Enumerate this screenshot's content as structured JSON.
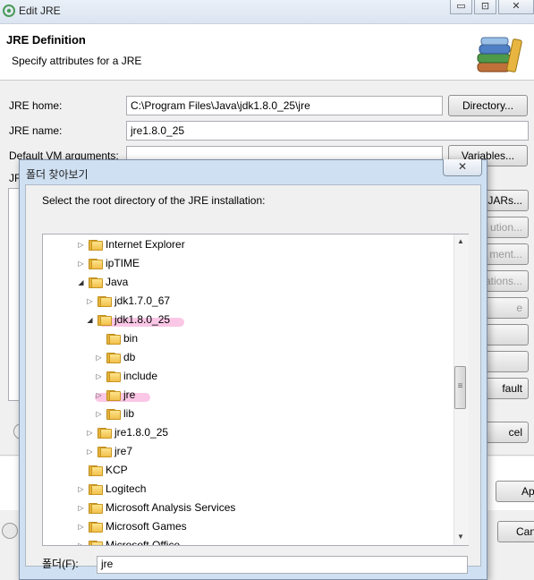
{
  "window": {
    "title": "Edit JRE",
    "controls": [
      "▭",
      "⊡",
      "✕"
    ]
  },
  "header": {
    "title": "JRE Definition",
    "subtitle": "Specify attributes for a JRE"
  },
  "form": {
    "jre_home_label": "JRE home:",
    "jre_home_value": "C:\\Program Files\\Java\\jdk1.8.0_25\\jre",
    "directory_button": "Directory...",
    "jre_name_label": "JRE name:",
    "jre_name_value": "jre1.8.0_25",
    "default_vm_label": "Default VM arguments:",
    "variables_button": "Variables...",
    "jre_libs_label_partial": "JR"
  },
  "side_buttons": [
    "JARs...",
    "ution...",
    "ment...",
    "ations...",
    "e",
    "",
    "",
    "fault"
  ],
  "bottom": {
    "cancel_partial": "cel",
    "apply_partial": "Ap",
    "cancel2_partial": "Can"
  },
  "dialog": {
    "title": "폴더 찾아보기",
    "close_glyph": "✕",
    "description": "Select the root directory of the JRE installation:",
    "folder_label": "폴더(F):",
    "folder_value": "jre",
    "tree": [
      {
        "name": "Internet Explorer",
        "twisty": "▷"
      },
      {
        "name": "ipTIME",
        "twisty": "▷"
      },
      {
        "name": "Java",
        "twisty": "◢"
      },
      {
        "name": "jdk1.7.0_67",
        "twisty": "▷"
      },
      {
        "name": "jdk1.8.0_25",
        "twisty": "◢"
      },
      {
        "name": "bin",
        "twisty": ""
      },
      {
        "name": "db",
        "twisty": "▷"
      },
      {
        "name": "include",
        "twisty": "▷"
      },
      {
        "name": "jre",
        "twisty": "▷"
      },
      {
        "name": "lib",
        "twisty": "▷"
      },
      {
        "name": "jre1.8.0_25",
        "twisty": "▷"
      },
      {
        "name": "jre7",
        "twisty": "▷"
      },
      {
        "name": "KCP",
        "twisty": ""
      },
      {
        "name": "Logitech",
        "twisty": "▷"
      },
      {
        "name": "Microsoft Analysis Services",
        "twisty": "▷"
      },
      {
        "name": "Microsoft Games",
        "twisty": "▷"
      },
      {
        "name": "Microsoft Office",
        "twisty": "▷"
      }
    ],
    "scroll": {
      "up": "▲",
      "down": "▼",
      "grip": "≡"
    }
  },
  "colors": {
    "highlight": "#f682c8",
    "folder": "#f2c04c",
    "titlebar": "#dbe4f0"
  }
}
